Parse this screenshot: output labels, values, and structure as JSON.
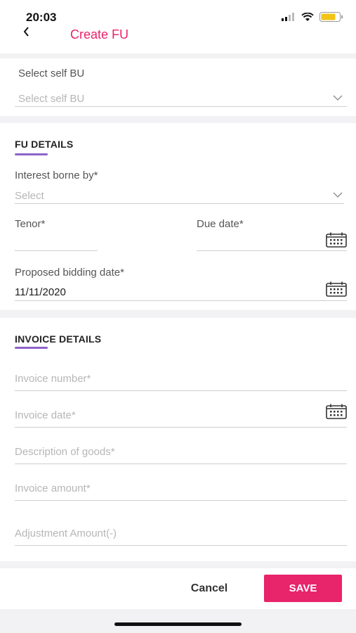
{
  "status_bar": {
    "time": "20:03"
  },
  "header": {
    "back_label": "<",
    "title": "Create FU"
  },
  "self_bu": {
    "label": "Select self BU",
    "placeholder": "Select self BU"
  },
  "fu_details": {
    "section_title": "FU DETAILS",
    "interest_label": "Interest borne by*",
    "interest_placeholder": "Select",
    "tenor_label": "Tenor*",
    "due_date_label": "Due date*",
    "bidding_label": "Proposed bidding date*",
    "bidding_value": "11/11/2020"
  },
  "invoice_details": {
    "section_title": "INVOICE DETAILS",
    "invoice_number": "Invoice number*",
    "invoice_date": "Invoice date*",
    "description": "Description of goods*",
    "invoice_amount": "Invoice amount*",
    "adjustment_amount": "Adjustment Amount(-)"
  },
  "footer": {
    "cancel_label": "Cancel",
    "save_label": "SAVE"
  },
  "colors": {
    "accent": "#e8246b",
    "section_underline": "#8d63c9"
  },
  "icons": [
    "chevron-left-icon",
    "signal-icon",
    "wifi-icon",
    "battery-icon",
    "chevron-down-icon",
    "calendar-icon"
  ]
}
